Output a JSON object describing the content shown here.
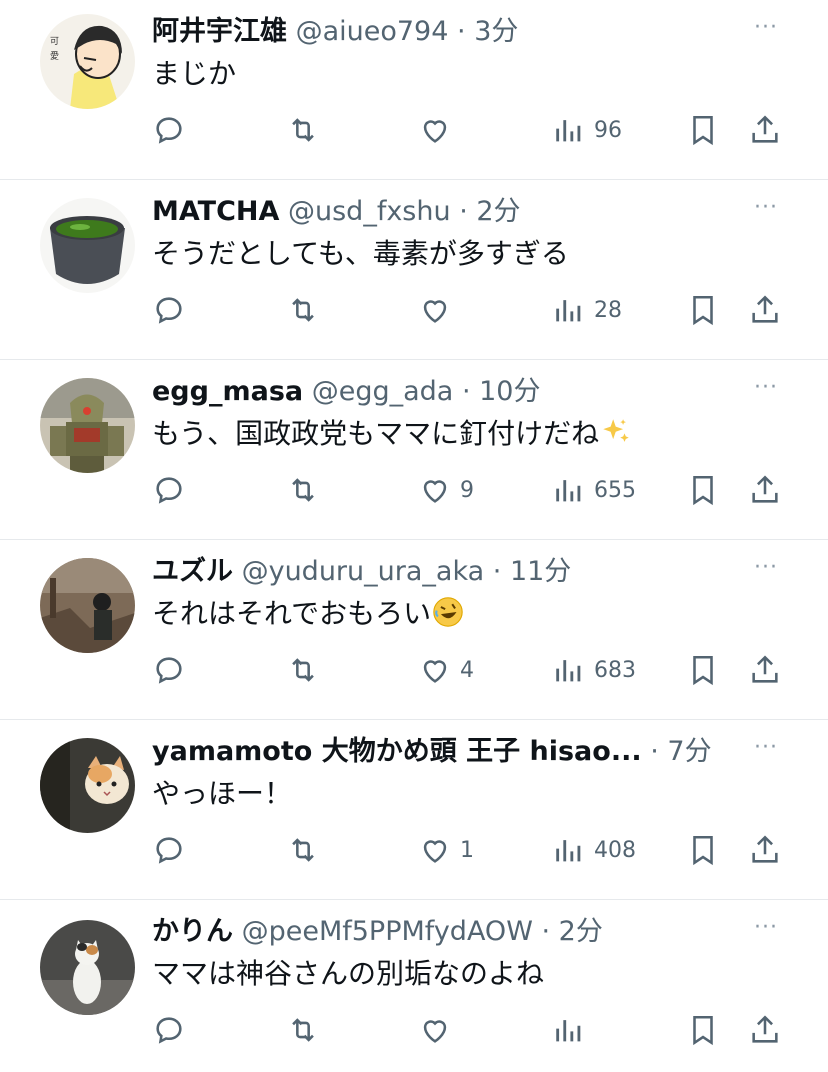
{
  "tweets": [
    {
      "name": "阿井宇江雄",
      "handle": "@aiueo794",
      "dot": "·",
      "time": "3分",
      "text": "まじか",
      "likes": "",
      "views": "96",
      "avatar": "illustration-avatar"
    },
    {
      "name": "MATCHA",
      "handle": "@usd_fxshu",
      "dot": "·",
      "time": "2分",
      "text": "そうだとしても、毒素が多すぎる",
      "likes": "",
      "views": "28",
      "avatar": "matcha-bowl-avatar"
    },
    {
      "name": "egg_masa",
      "handle": "@egg_ada",
      "dot": "·",
      "time": "10分",
      "text": "もう、国政政党もママに釘付けだね",
      "emoji": "sparkles-emoji",
      "likes": "9",
      "views": "655",
      "avatar": "robot-figure-avatar"
    },
    {
      "name": "ユズル",
      "handle": "@yuduru_ura_aka",
      "dot": "·",
      "time": "11分",
      "text": "それはそれでおもろい",
      "emoji": "rolling-laughing-emoji",
      "likes": "4",
      "views": "683",
      "avatar": "outdoor-person-avatar"
    },
    {
      "name": "yamamoto 大物かめ頭 王子 hisao...",
      "handle": "",
      "dot": "·",
      "time": "7分",
      "text": "やっほー！",
      "likes": "1",
      "views": "408",
      "avatar": "cat-photo-avatar"
    },
    {
      "name": "かりん",
      "handle": "@peeMf5PPMfydAOW",
      "dot": "·",
      "time": "2分",
      "text": "ママは神谷さんの別垢なのよね",
      "likes": "",
      "views": "",
      "avatar": "white-cat-avatar"
    }
  ],
  "more_label": "···",
  "icons": [
    "reply-icon",
    "retweet-icon",
    "like-icon",
    "views-icon",
    "bookmark-icon",
    "share-icon"
  ],
  "colors": {
    "text": "#0f1419",
    "secondary": "#536471",
    "divider": "#e6e9ec"
  }
}
